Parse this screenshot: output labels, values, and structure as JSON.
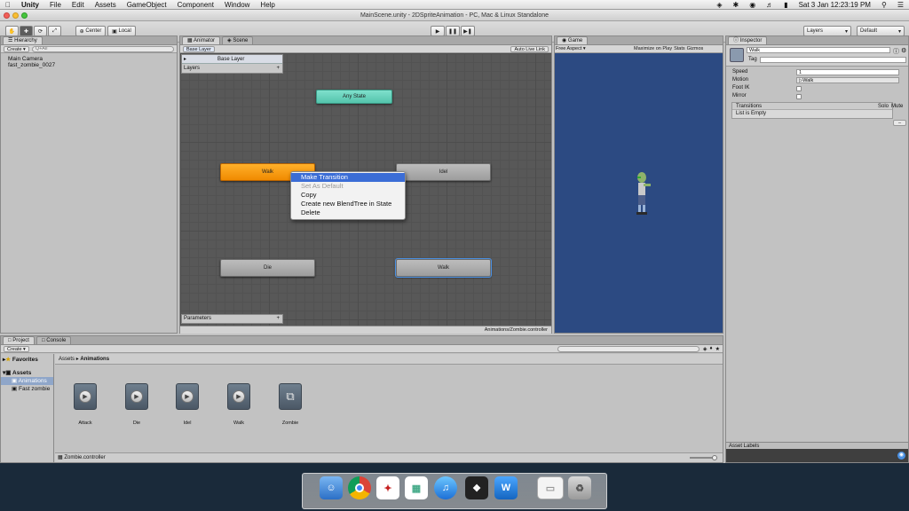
{
  "menubar": {
    "apple": "",
    "items": [
      "Unity",
      "File",
      "Edit",
      "Assets",
      "GameObject",
      "Component",
      "Window",
      "Help"
    ],
    "clock": "Sat 3 Jan  12:23:19 PM"
  },
  "window": {
    "title": "MainScene.unity - 2DSpriteAnimation - PC, Mac & Linux Standalone"
  },
  "toolbar": {
    "center_label": "Center",
    "local_label": "Local",
    "layers_label": "Layers",
    "layout_label": "Default"
  },
  "hierarchy": {
    "tab": "Hierarchy",
    "create": "Create",
    "search_placeholder": "Q+All",
    "items": [
      "Main Camera",
      "fast_zombie_0027"
    ]
  },
  "animator": {
    "tab_animator": "Animator",
    "tab_scene": "Scene",
    "breadcrumb": "Base Layer",
    "auto_live_link": "Auto Live Link",
    "layer_row": "Base Layer",
    "layers_label": "Layers",
    "parameters_label": "Parameters",
    "footer_path": "Animations/Zombie.controller",
    "states": {
      "any_state": "Any State",
      "walk_default": "Walk",
      "idel": "Idel",
      "die": "Die",
      "walk_selected": "Walk"
    },
    "context_menu": [
      "Make Transition",
      "Set As Default",
      "Copy",
      "Create new BlendTree in State",
      "Delete"
    ]
  },
  "game": {
    "tab": "Game",
    "aspect": "Free Aspect",
    "maximize": "Maximize on Play",
    "stats": "Stats",
    "gizmos": "Gizmos"
  },
  "inspector": {
    "tab": "Inspector",
    "name": "Walk",
    "tag_label": "Tag",
    "speed_label": "Speed",
    "speed_value": "1",
    "motion_label": "Motion",
    "motion_value": "Walk",
    "footik_label": "Foot IK",
    "mirror_label": "Mirror",
    "transitions_label": "Transitions",
    "solo_label": "Solo",
    "mute_label": "Mute",
    "list_empty": "List is Empty",
    "remove_btn": "–",
    "asset_labels": "Asset Labels"
  },
  "project": {
    "tab_project": "Project",
    "tab_console": "Console",
    "create": "Create",
    "favorites": "Favorites",
    "assets": "Assets",
    "animations_folder": "Animations",
    "fast_zombie_folder": "Fast zombie",
    "breadcrumb_root": "Assets",
    "breadcrumb_sep": "▸",
    "breadcrumb_current": "Animations",
    "items": [
      "Attack",
      "Die",
      "Idel",
      "Walk",
      "Zombie"
    ],
    "footer_file": "Zombie.controller"
  },
  "colors": {
    "accent_blue": "#3b6dd6",
    "state_orange": "#f49a10",
    "state_teal": "#66d0b9",
    "game_bg": "#2c4a82"
  }
}
